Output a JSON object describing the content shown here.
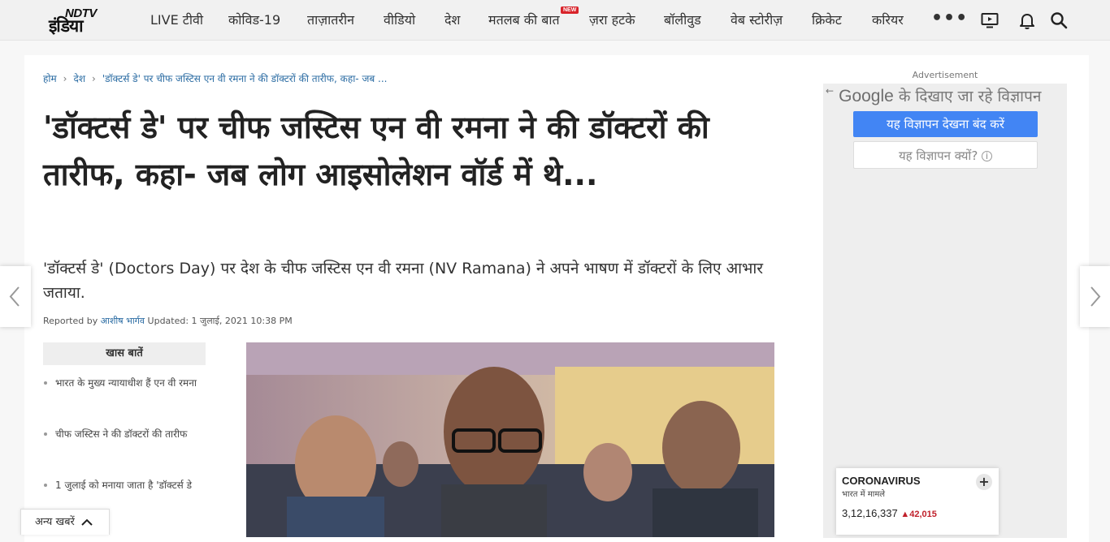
{
  "logo": {
    "text_en": "NDTV",
    "text_hi": "इंडिया"
  },
  "nav": {
    "items": [
      "LIVE टीवी",
      "कोविड-19",
      "ताज़ातरीन",
      "वीडियो",
      "देश",
      "मतलब की बात",
      "ज़रा हटके",
      "बॉलीवुड",
      "वेब स्टोरीज़",
      "क्रिकेट",
      "करियर"
    ],
    "new_badge": "NEW",
    "more": "•••"
  },
  "breadcrumb": {
    "home": "होम",
    "section": "देश",
    "current": "'डॉक्टर्स डे' पर चीफ जस्टिस एन वी रमना ने की डॉक्टरों की तारीफ, कहा- जब ..."
  },
  "article": {
    "headline": "'डॉक्टर्स डे' पर चीफ जस्टिस एन वी रमना ने की डॉक्टरों की तारीफ, कहा- जब लोग आइसोलेशन वॉर्ड में थे...",
    "summary": "'डॉक्टर्स डे' (Doctors Day) पर देश के चीफ जस्टिस एन वी रमना (NV Ramana) ने अपने भाषण में डॉक्टरों के लिए आभार जताया.",
    "reported_by": "Reported by",
    "author": "आशीष भार्गव",
    "updated": "Updated: 1 जुलाई, 2021 10:38 PM"
  },
  "highlights": {
    "title": "खास बातें",
    "items": [
      "भारत के मुख्य न्यायाधीश हैं एन वी रमना",
      "चीफ जस्टिस ने की डॉक्टरों की तारीफ",
      "1 जुलाई को मनाया जाता है 'डॉक्टर्स डे"
    ]
  },
  "ad": {
    "label": "Advertisement",
    "google": "Google",
    "title_rest": "के दिखाए जा रहे विज्ञापन",
    "stop_button": "यह विज्ञापन देखना बंद करें",
    "why_button": "यह विज्ञापन क्यों?"
  },
  "corona": {
    "title": "CORONAVIRUS",
    "subtitle": "भारत में मामले",
    "plus": "+",
    "count": "3,12,16,337",
    "delta": "42,015"
  },
  "other_news": {
    "label": "अन्य खबरें"
  },
  "colors": {
    "link": "#2b6ca3",
    "badge": "#d8232a",
    "ad_button": "#4285f4"
  }
}
